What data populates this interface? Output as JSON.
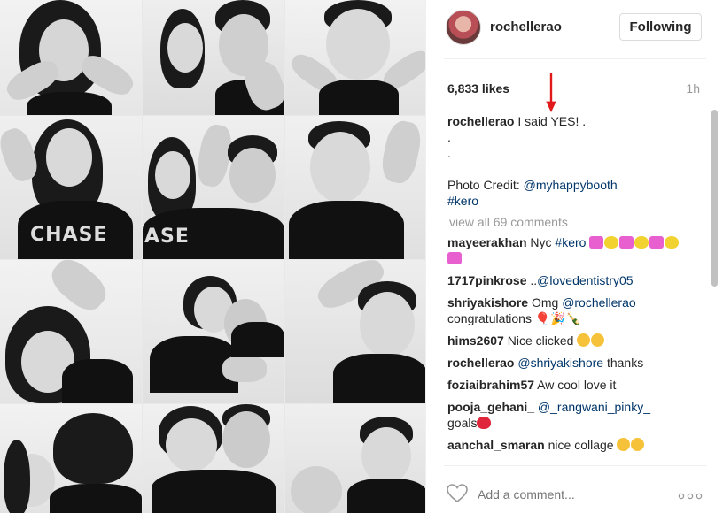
{
  "post": {
    "username": "rochellerao",
    "follow_label": "Following",
    "likes": "6,833 likes",
    "time": "1h",
    "caption_user": "rochellerao",
    "caption_text": "I said YES! .",
    "caption_dot1": ".",
    "caption_dot2": ".",
    "photo_credit_label": "Photo Credit:",
    "photo_credit_link": "@myhappybooth",
    "hashtag": "#kero",
    "view_all": "view all 69 comments"
  },
  "comments": [
    {
      "user": "mayeerakhan",
      "text": "Nyc",
      "link": "#kero",
      "emoji": "hearts"
    },
    {
      "user": "1717pinkrose",
      "text": "..",
      "link": "@lovedentistry05"
    },
    {
      "user": "shriyakishore",
      "text": "Omg",
      "link": "@rochellerao",
      "text2": "congratulations",
      "emoji": "party"
    },
    {
      "user": "hims2607",
      "text": "Nice clicked",
      "emoji": "ok"
    },
    {
      "user": "rochellerao",
      "link": "@shriyakishore",
      "text2": "thanks"
    },
    {
      "user": "foziaibrahim57",
      "text": "Aw cool love it"
    },
    {
      "user": "pooja_gehani_",
      "link": "@_rangwani_pinky_",
      "text2": "goals",
      "emoji": "heart"
    },
    {
      "user": "aanchal_smaran",
      "text": "nice collage",
      "emoji": "hearteyes"
    }
  ],
  "footer": {
    "add_comment_placeholder": "Add a comment...",
    "more_label": "..."
  },
  "colors": {
    "link": "#003569",
    "muted": "#999999",
    "arrow": "#e0191b"
  },
  "icons": [
    "heart-icon",
    "more-options-icon",
    "red-arrow-annotation"
  ]
}
